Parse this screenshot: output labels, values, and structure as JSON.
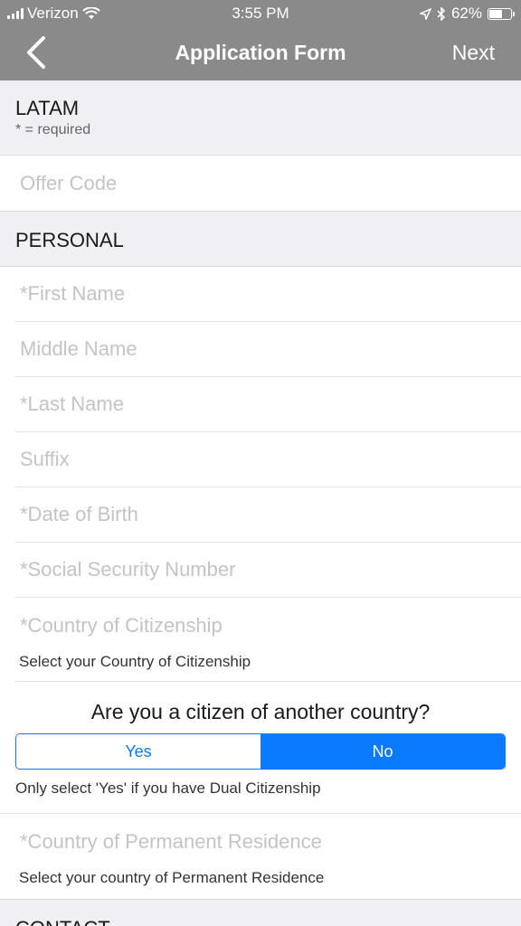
{
  "status_bar": {
    "carrier": "Verizon",
    "time": "3:55 PM",
    "battery": "62%",
    "battery_level": 0.62
  },
  "nav": {
    "title": "Application Form",
    "next_label": "Next"
  },
  "form_header": {
    "name": "LATAM",
    "required_note": "* = required"
  },
  "offer_code": {
    "placeholder": "Offer Code"
  },
  "personal": {
    "header": "PERSONAL",
    "first_name": "*First Name",
    "middle_name": "Middle Name",
    "last_name": "*Last Name",
    "suffix": "Suffix",
    "dob": "*Date of Birth",
    "ssn": "*Social Security Number",
    "citizenship": "*Country of Citizenship",
    "citizenship_hint": "Select your Country of Citizenship",
    "dual_question": "Are you a citizen of another country?",
    "yes_label": "Yes",
    "no_label": "No",
    "selected": "No",
    "dual_hint": "Only select 'Yes' if you have Dual Citizenship",
    "residence": "*Country of Permanent Residence",
    "residence_hint": "Select your country of Permanent Residence"
  },
  "contact": {
    "header": "CONTACT"
  },
  "colors": {
    "accent": "#0a7aff",
    "navbar": "#8a8a8a",
    "section_bg": "#efeff4"
  }
}
